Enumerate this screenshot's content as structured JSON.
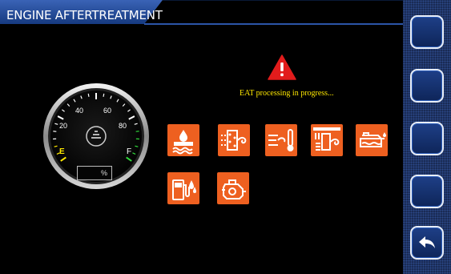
{
  "header": {
    "title": "ENGINE AFTERTREATMENT"
  },
  "gauge": {
    "tick_labels": [
      "20",
      "40",
      "60",
      "80"
    ],
    "empty_label": "E",
    "full_label": "F",
    "percent_unit": "%",
    "percent_value": ""
  },
  "status": {
    "message": "EAT processing in progress..."
  },
  "icons": [
    "exhaust-fluid-icon",
    "dpf-icon",
    "exhaust-temperature-icon",
    "def-filter-icon",
    "oil-level-icon",
    "fuel-def-icon",
    "engine-icon"
  ],
  "side_buttons": [
    "blank",
    "blank",
    "blank",
    "blank",
    "back-arrow"
  ],
  "colors": {
    "tile": "#ee6020",
    "accent": "#ffe800",
    "header": "#1f3f88",
    "warning": "#e21c1c"
  }
}
